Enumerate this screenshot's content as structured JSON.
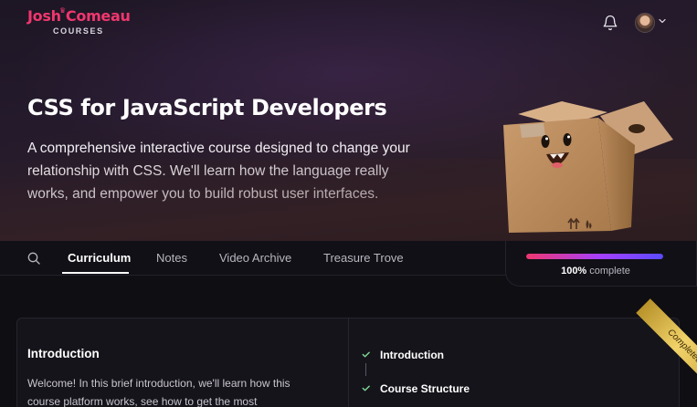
{
  "brand": {
    "name": "Josh Comeau",
    "sub": "COURSES",
    "accent": "#f0376e"
  },
  "header": {
    "bell_icon": "bell-icon",
    "avatar_icon": "user-avatar",
    "chevron_icon": "chevron-down-icon"
  },
  "hero": {
    "title": "CSS for JavaScript Developers",
    "description": "A comprehensive interactive course designed to change your relationship with CSS. We'll learn how the language really works, and empower you to build robust user interfaces."
  },
  "nav": {
    "search_icon": "search-icon",
    "tabs": [
      {
        "label": "Curriculum",
        "active": true
      },
      {
        "label": "Notes",
        "active": false
      },
      {
        "label": "Video Archive",
        "active": false
      },
      {
        "label": "Treasure Trove",
        "active": false
      }
    ]
  },
  "progress": {
    "percent_value": 100,
    "percent_text": "100%",
    "suffix": "complete"
  },
  "module": {
    "title": "Introduction",
    "body": "Welcome! In this brief introduction, we'll learn how this course platform works, see how to get the most",
    "ribbon": "Completed!",
    "steps": [
      {
        "label": "Introduction",
        "status": "completed"
      },
      {
        "label": "Course Structure",
        "status": "completed"
      }
    ]
  }
}
